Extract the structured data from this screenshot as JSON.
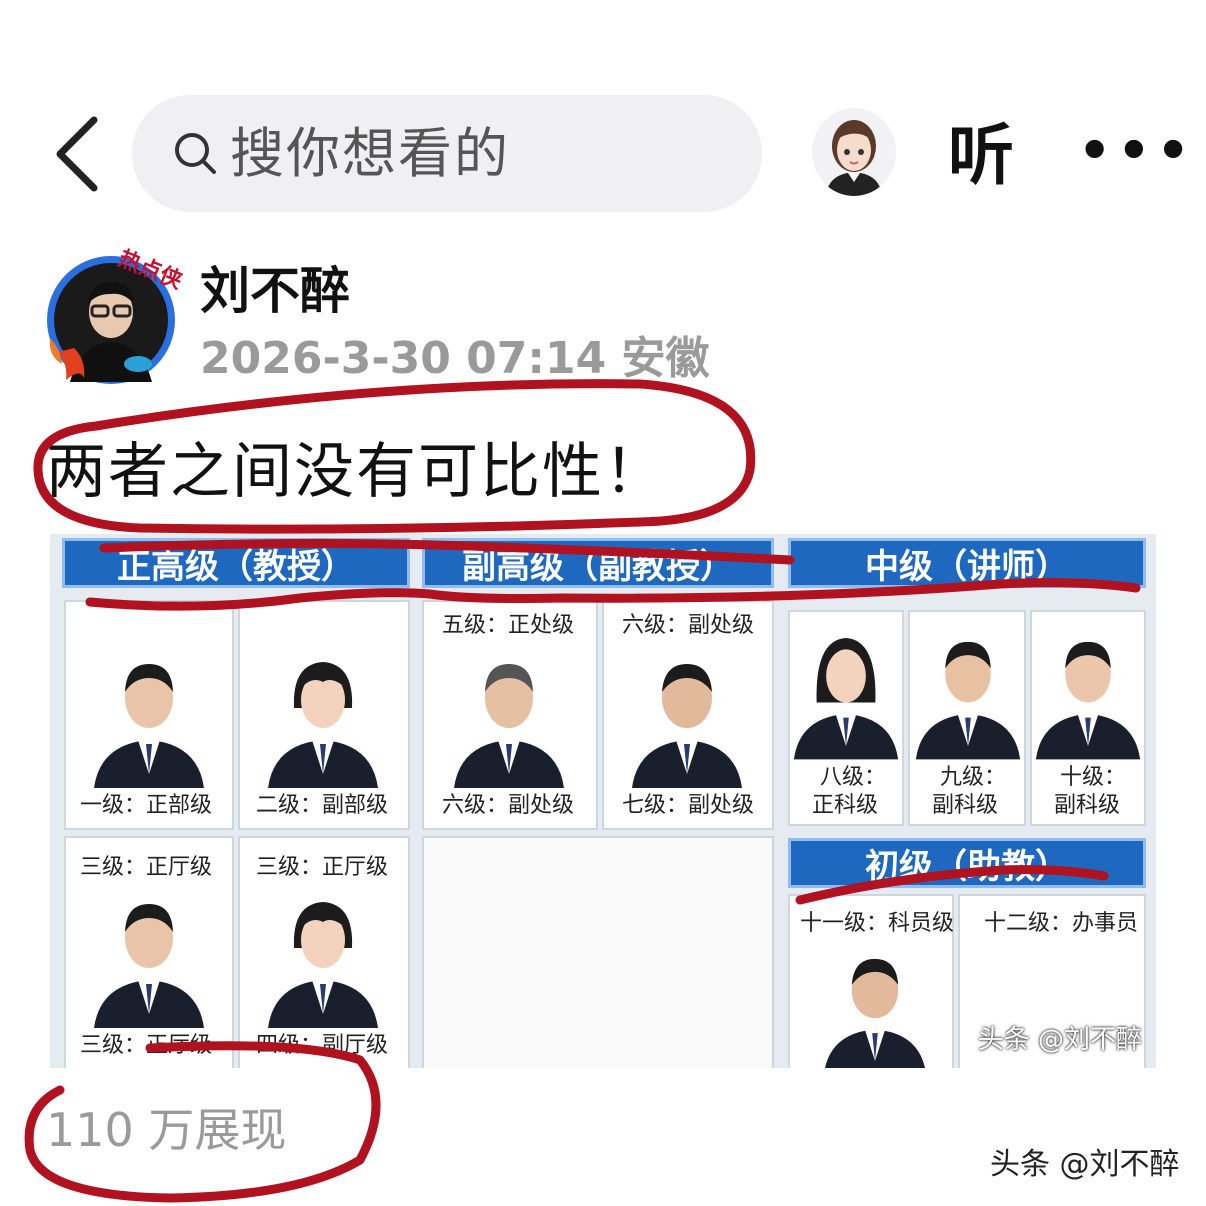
{
  "header": {
    "search_placeholder": "搜你想看的",
    "listen_label": "听",
    "more_label": "•••"
  },
  "post": {
    "author": "刘不醉",
    "avatar_badge": "热点侠",
    "meta": "2026-3-30 07:14  安徽",
    "text": "两者之间没有可比性！",
    "views": "110 万展现"
  },
  "image": {
    "headers": {
      "h1": "正高级（教授）",
      "h2": "副高级（副教授）",
      "h3": "中级（讲师）",
      "h4": "初级（助教）"
    },
    "labels": {
      "c1_bottom": "一级：正部级",
      "c2_bottom": "二级：副部级",
      "c3_top": "五级：正处级",
      "c3_bottom": "六级：副处级",
      "c4_top": "六级：副处级",
      "c4_bottom": "七级：副处级",
      "c5_b1": "八级：",
      "c5_b2": "正科级",
      "c6_b1": "九级：",
      "c6_b2": "副科级",
      "c7_b1": "十级：",
      "c7_b2": "副科级",
      "c8_top": "三级：正厅级",
      "c8_bottom": "三级：正厅级",
      "c9_top": "三级：正厅级",
      "c9_bottom": "四级：副厅级",
      "c10_top": "十一级：科员级",
      "c11_top": "十二级：办事员"
    },
    "watermark": "头条 @刘不醉"
  },
  "page_watermark": "头条 @刘不醉",
  "colors": {
    "header_blue": "#1f68bf",
    "annotation_red": "#b0121f"
  }
}
